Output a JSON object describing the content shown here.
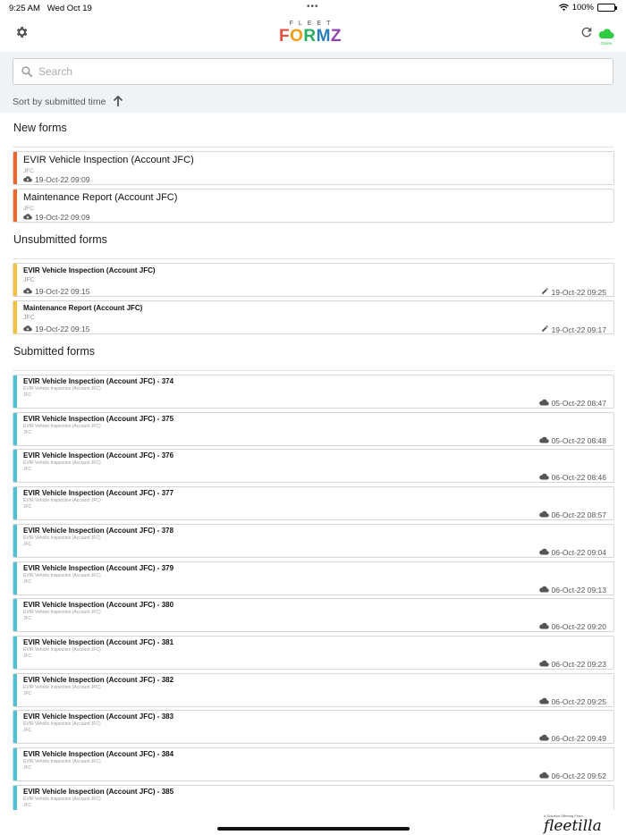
{
  "status_bar": {
    "time": "9:25 AM",
    "date": "Wed Oct 19",
    "dots": "•••",
    "battery": "100%"
  },
  "header": {
    "logo_top": "FLEET",
    "logo_letters": [
      "F",
      "O",
      "R",
      "M",
      "Z"
    ],
    "logo_colors": [
      "#e74c3c",
      "#f39c12",
      "#27ae60",
      "#2980b9",
      "#8e44ad"
    ],
    "online_label": "Online",
    "online_color": "#2ecc40"
  },
  "search": {
    "placeholder": "Search",
    "value": ""
  },
  "sort": {
    "label": "Sort by submitted time"
  },
  "sections": {
    "new_title": "New forms",
    "unsubmitted_title": "Unsubmitted forms",
    "submitted_title": "Submitted forms"
  },
  "new_forms": [
    {
      "title": "EVIR Vehicle Inspection (Account JFC)",
      "account": "JFC",
      "downloaded": "19-Oct-22 09:09"
    },
    {
      "title": "Maintenance Report (Account JFC)",
      "account": "JFC",
      "downloaded": "19-Oct-22 09:09"
    }
  ],
  "unsubmitted_forms": [
    {
      "title": "EVIR Vehicle Inspection (Account JFC)",
      "account": "JFC",
      "downloaded": "19-Oct-22 09:15",
      "edited": "19-Oct-22 09:25"
    },
    {
      "title": "Maintenance Report (Account JFC)",
      "account": "JFC",
      "downloaded": "19-Oct-22 09:15",
      "edited": "19-Oct-22 09:17"
    }
  ],
  "submitted_forms": [
    {
      "title": "EVIR Vehicle Inspection (Account JFC) - 374",
      "form": "EVIR Vehicle Inspection (Account JFC)",
      "account": "JFC",
      "submitted": "05-Oct-22 08:47"
    },
    {
      "title": "EVIR Vehicle Inspection (Account JFC) - 375",
      "form": "EVIR Vehicle Inspection (Account JFC)",
      "account": "JFC",
      "submitted": "05-Oct-22 08:48"
    },
    {
      "title": "EVIR Vehicle Inspection (Account JFC) - 376",
      "form": "EVIR Vehicle Inspection (Account JFC)",
      "account": "JFC",
      "submitted": "06-Oct-22 08:46"
    },
    {
      "title": "EVIR Vehicle Inspection (Account JFC) - 377",
      "form": "EVIR Vehicle Inspection (Account JFC)",
      "account": "JFC",
      "submitted": "06-Oct-22 08:57"
    },
    {
      "title": "EVIR Vehicle Inspection (Account JFC) - 378",
      "form": "EVIR Vehicle Inspection (Account JFC)",
      "account": "JFC",
      "submitted": "06-Oct-22 09:04"
    },
    {
      "title": "EVIR Vehicle Inspection (Account JFC) - 379",
      "form": "EVIR Vehicle Inspection (Account JFC)",
      "account": "JFC",
      "submitted": "06-Oct-22 09:13"
    },
    {
      "title": "EVIR Vehicle Inspection (Account JFC) - 380",
      "form": "EVIR Vehicle Inspection (Account JFC)",
      "account": "JFC",
      "submitted": "06-Oct-22 09:20"
    },
    {
      "title": "EVIR Vehicle Inspection (Account JFC) - 381",
      "form": "EVIR Vehicle Inspection (Account JFC)",
      "account": "JFC",
      "submitted": "06-Oct-22 09:23"
    },
    {
      "title": "EVIR Vehicle Inspection (Account JFC) - 382",
      "form": "EVIR Vehicle Inspection (Account JFC)",
      "account": "JFC",
      "submitted": "06-Oct-22 09:25"
    },
    {
      "title": "EVIR Vehicle Inspection (Account JFC) - 383",
      "form": "EVIR Vehicle Inspection (Account JFC)",
      "account": "JFC",
      "submitted": "06-Oct-22 09:49"
    },
    {
      "title": "EVIR Vehicle Inspection (Account JFC) - 384",
      "form": "EVIR Vehicle Inspection (Account JFC)",
      "account": "JFC",
      "submitted": "06-Oct-22 09:52"
    },
    {
      "title": "EVIR Vehicle Inspection (Account JFC) - 385",
      "form": "EVIR Vehicle Inspection (Account JFC)",
      "account": "JFC",
      "submitted": ""
    }
  ],
  "footer": {
    "tagline": "A Solution Offering From",
    "brand": "fleetilla"
  },
  "accent_colors": {
    "new": "#f0652b",
    "unsubmitted": "#f5c43a",
    "submitted": "#4fc1d4"
  }
}
